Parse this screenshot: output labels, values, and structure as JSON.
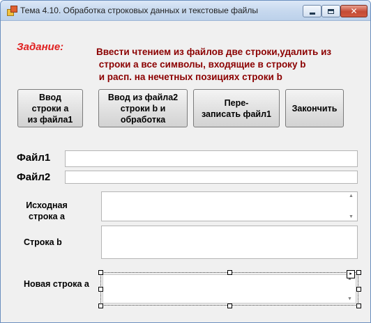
{
  "window": {
    "title": "Тема 4.10. Обработка строковых данных и текстовые файлы"
  },
  "task": {
    "label": "Задание:",
    "lines": [
      "Ввести чтением из файлов две строки,удалить из",
      " строки a все символы, входящие в строку b",
      " и расп. на нечетных позициях строки b"
    ]
  },
  "buttons": {
    "load_file1": "Ввод\nстроки а\nиз файла1",
    "load_file2": "Ввод из файла2\nстроки b и\nобработка",
    "rewrite_file1": "Пере-\nзаписать файл1",
    "finish": "Закончить"
  },
  "fields": {
    "file1_label": "Файл1",
    "file1_value": "",
    "file2_label": "Файл2",
    "file2_value": "",
    "source_a_label": "Исходная\nстрока а",
    "source_a_value": "",
    "string_b_label": "Строка b",
    "string_b_value": "",
    "new_a_label": "Новая строка а",
    "new_a_value": ""
  },
  "colors": {
    "task_label": "#e02020",
    "task_text": "#8b0000",
    "window_bg": "#f0f0f0",
    "title_bar": "#c6d8ee"
  },
  "icons": {
    "app": "app-icon",
    "minimize": "minimize-icon",
    "maximize": "maximize-icon",
    "close": "close-icon",
    "smart_tag": "smart-tag-icon"
  }
}
